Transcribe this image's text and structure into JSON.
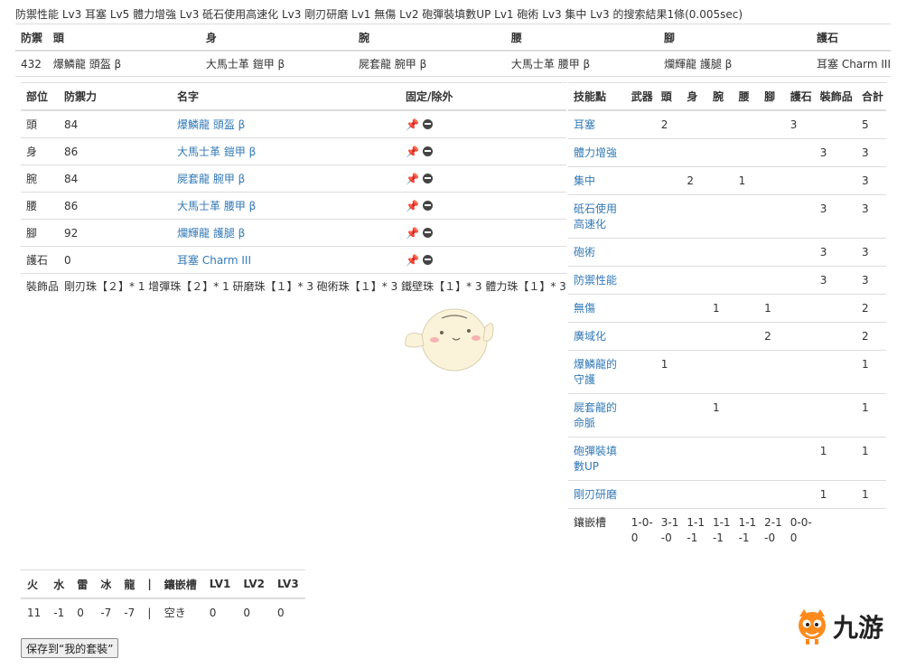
{
  "result_line": "防禦性能 Lv3 耳塞 Lv5 體力增強 Lv3 砥石使用高速化 Lv3 剛刃研磨 Lv1 無傷 Lv2 砲彈裝填數UP Lv1 砲術 Lv3 集中 Lv3 的搜索結果1條(0.005sec)",
  "summary": {
    "headers": [
      "防禦",
      "頭",
      "身",
      "腕",
      "腰",
      "腳",
      "護石"
    ],
    "row": [
      "432",
      "爆鱗龍 頭盔 β",
      "大馬士革 鎧甲 β",
      "屍套龍 腕甲 β",
      "大馬士革 腰甲 β",
      "爛輝龍 護腿 β",
      "耳塞 Charm III"
    ]
  },
  "equipment": {
    "headers": [
      "部位",
      "防禦力",
      "名字",
      "固定/除外"
    ],
    "rows": [
      {
        "part": "頭",
        "defense": "84",
        "name": "爆鱗龍 頭盔 β"
      },
      {
        "part": "身",
        "defense": "86",
        "name": "大馬士革 鎧甲 β"
      },
      {
        "part": "腕",
        "defense": "84",
        "name": "屍套龍 腕甲 β"
      },
      {
        "part": "腰",
        "defense": "86",
        "name": "大馬士革 腰甲 β"
      },
      {
        "part": "腳",
        "defense": "92",
        "name": "爛輝龍 護腿 β"
      },
      {
        "part": "護石",
        "defense": "0",
        "name": "耳塞 Charm III"
      }
    ],
    "decoration_label": "裝飾品",
    "decoration_text": "剛刃珠【２】* 1 增彈珠【２】* 1 研磨珠【１】* 3 砲術珠【１】* 3 鐵壁珠【１】* 3 體力珠【１】* 3"
  },
  "skills": {
    "headers": [
      "技能點",
      "武器",
      "頭",
      "身",
      "腕",
      "腰",
      "腳",
      "護石",
      "裝飾品",
      "合計"
    ],
    "rows": [
      {
        "name": "耳塞",
        "cells": [
          "",
          "2",
          "",
          "",
          "",
          "",
          "3",
          "",
          "5"
        ]
      },
      {
        "name": "體力增強",
        "cells": [
          "",
          "",
          "",
          "",
          "",
          "",
          "",
          "3",
          "3"
        ]
      },
      {
        "name": "集中",
        "cells": [
          "",
          "",
          "2",
          "",
          "1",
          "",
          "",
          "",
          "3"
        ]
      },
      {
        "name": "砥石使用高速化",
        "cells": [
          "",
          "",
          "",
          "",
          "",
          "",
          "",
          "3",
          "3"
        ]
      },
      {
        "name": "砲術",
        "cells": [
          "",
          "",
          "",
          "",
          "",
          "",
          "",
          "3",
          "3"
        ]
      },
      {
        "name": "防禦性能",
        "cells": [
          "",
          "",
          "",
          "",
          "",
          "",
          "",
          "3",
          "3"
        ]
      },
      {
        "name": "無傷",
        "cells": [
          "",
          "",
          "",
          "1",
          "",
          "1",
          "",
          "",
          "2"
        ]
      },
      {
        "name": "廣域化",
        "cells": [
          "",
          "",
          "",
          "",
          "",
          "2",
          "",
          "",
          "2"
        ]
      },
      {
        "name": "爆鱗龍的守護",
        "cells": [
          "",
          "1",
          "",
          "",
          "",
          "",
          "",
          "",
          "1"
        ]
      },
      {
        "name": "屍套龍的命脈",
        "cells": [
          "",
          "",
          "",
          "1",
          "",
          "",
          "",
          "",
          "1"
        ]
      },
      {
        "name": "砲彈裝填數UP",
        "cells": [
          "",
          "",
          "",
          "",
          "",
          "",
          "",
          "1",
          "1"
        ]
      },
      {
        "name": "剛刃研磨",
        "cells": [
          "",
          "",
          "",
          "",
          "",
          "",
          "",
          "1",
          "1"
        ]
      }
    ],
    "slots_label": "鑲嵌槽",
    "slots": [
      "1-0-0",
      "3-1-0",
      "1-1-1",
      "1-1-1",
      "1-1-1",
      "2-1-0",
      "0-0-0"
    ]
  },
  "resistance": {
    "headers": [
      "火",
      "水",
      "雷",
      "冰",
      "龍",
      "|",
      "鑲嵌槽",
      "LV1",
      "LV2",
      "LV3"
    ],
    "values": [
      "11",
      "-1",
      "0",
      "-7",
      "-7",
      "|",
      "空き",
      "0",
      "0",
      "0"
    ]
  },
  "save_button": "保存到“我的套裝”",
  "watermark_text": "九游",
  "colors": {
    "link": "#337ab7",
    "border": "#dddddd",
    "text": "#333333",
    "watermark_orange": "#ff8a1c"
  }
}
